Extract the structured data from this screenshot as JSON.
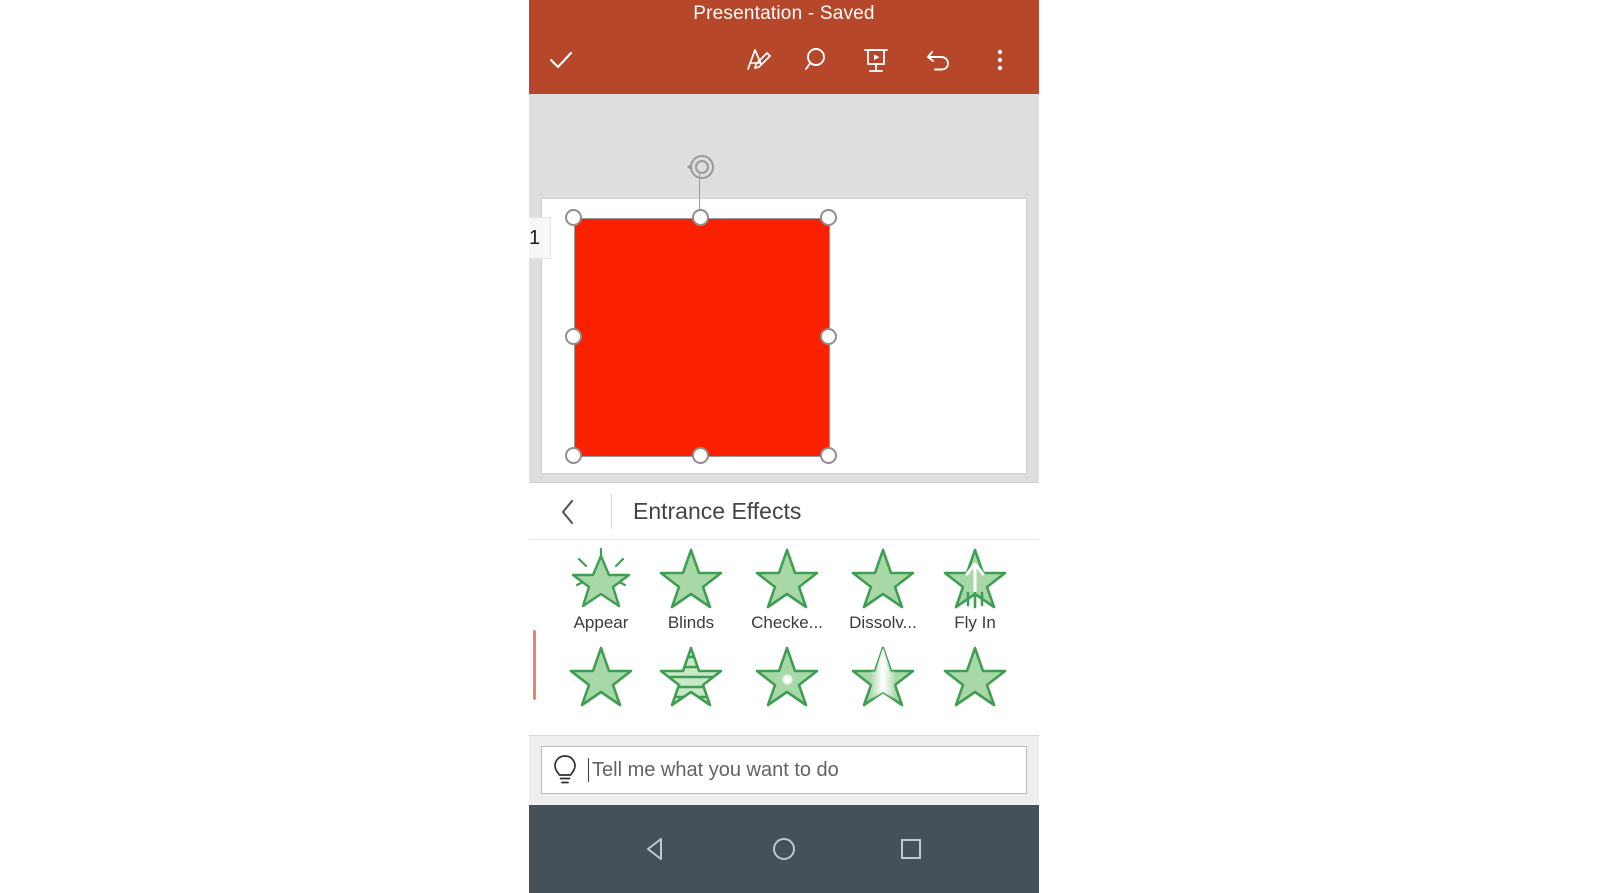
{
  "app": {
    "title": "Presentation - Saved",
    "brand_color": "#b7472a",
    "shape_color": "#fa2000"
  },
  "toolbar": {
    "done_label": "done-check",
    "items": [
      {
        "name": "ink-icon",
        "label": "Ink"
      },
      {
        "name": "search-icon",
        "label": "Search"
      },
      {
        "name": "present-icon",
        "label": "Present"
      },
      {
        "name": "undo-icon",
        "label": "Undo"
      },
      {
        "name": "more-icon",
        "label": "More options"
      }
    ]
  },
  "canvas": {
    "slide_number": "1",
    "shape": {
      "type": "rectangle",
      "fill": "#fa2000",
      "selected": true,
      "handles": 8,
      "rotate_handle": true
    }
  },
  "panel": {
    "back_label": "Back",
    "title": "Entrance Effects",
    "effects_row1": [
      {
        "label": "Appear",
        "icon": "star-sparkle-icon"
      },
      {
        "label": "Blinds",
        "icon": "star-plain-icon"
      },
      {
        "label": "Checke...",
        "icon": "star-plain-icon"
      },
      {
        "label": "Dissolv...",
        "icon": "star-plain-icon"
      },
      {
        "label": "Fly In",
        "icon": "star-arrow-up-icon"
      }
    ],
    "effects_row2": [
      {
        "label": "",
        "icon": "star-plain-icon"
      },
      {
        "label": "",
        "icon": "star-stripes-icon"
      },
      {
        "label": "",
        "icon": "star-center-glow-icon"
      },
      {
        "label": "",
        "icon": "star-split-icon"
      },
      {
        "label": "",
        "icon": "star-plain-icon"
      }
    ]
  },
  "tellme": {
    "placeholder": "Tell me what you want to do",
    "icon": "lightbulb-icon"
  },
  "navbar": {
    "back": "back-triangle-icon",
    "home": "home-circle-icon",
    "recents": "recents-square-icon"
  }
}
